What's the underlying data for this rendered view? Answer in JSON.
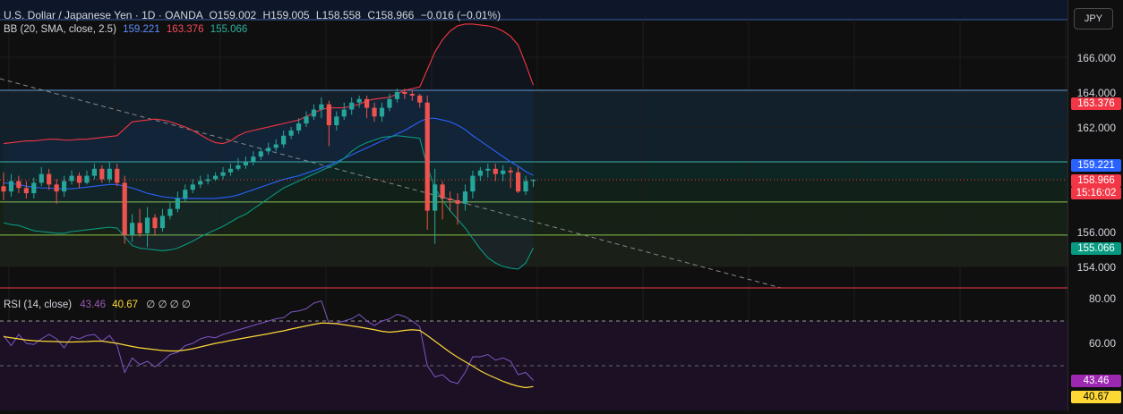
{
  "header": {
    "symbol": "U.S. Dollar / Japanese Yen · 1D · OANDA",
    "open": "O159.002",
    "high": "H159.005",
    "low": "L158.558",
    "close": "C158.966",
    "change": "−0.016 (−0.01%)"
  },
  "bb_legend": {
    "label": "BB (20, SMA, close, 2.5)",
    "basis": "159.221",
    "upper": "163.376",
    "lower": "155.066"
  },
  "rsi_legend": {
    "label": "RSI (14, close)",
    "rsi": "43.46",
    "rsi_ma": "40.67",
    "extra": "∅ ∅ ∅ ∅"
  },
  "currency_button": "JPY",
  "price_ticks": [
    "166.000",
    "164.000",
    "162.000",
    "156.000",
    "154.000"
  ],
  "rsi_ticks": [
    "80.00",
    "60.00"
  ],
  "labels": {
    "upper": "163.376",
    "basis": "159.221",
    "last": "158.966",
    "countdown": "15:16:02",
    "lower": "155.066",
    "rsi": "43.46",
    "rsi_ma": "40.67"
  },
  "colors": {
    "up": "#26a69a",
    "down": "#ef5350",
    "upper_band": "#f23645",
    "basis": "#2962ff",
    "lower_band": "#089981",
    "rsi": "#7e57c2",
    "rsi_ma": "#fdd835",
    "hline_blue": "#5b9bd5",
    "hline_teal": "#3fb1a7",
    "hline_green": "#8bc34a"
  },
  "chart_data": [
    {
      "type": "candlestick",
      "title": "U.S. Dollar / Japanese Yen · 1D · OANDA",
      "ylim": [
        153.2,
        168.4
      ],
      "ticks": [
        154,
        156,
        162,
        164,
        166
      ],
      "series": [
        {
          "name": "OHLC",
          "values": [
            [
              158.6,
              158.3,
              159.4,
              157.8
            ],
            [
              158.3,
              158.9,
              159.3,
              158.0
            ],
            [
              158.9,
              158.5,
              159.2,
              158.2
            ],
            [
              158.5,
              158.2,
              158.9,
              157.9
            ],
            [
              158.2,
              158.8,
              159.1,
              157.9
            ],
            [
              158.8,
              159.3,
              159.7,
              158.6
            ],
            [
              159.3,
              158.7,
              159.6,
              158.4
            ],
            [
              158.7,
              158.3,
              159.0,
              157.6
            ],
            [
              158.3,
              158.9,
              159.2,
              158.0
            ],
            [
              158.9,
              159.2,
              159.5,
              158.7
            ],
            [
              159.2,
              158.8,
              159.4,
              158.5
            ],
            [
              158.8,
              159.2,
              159.5,
              158.7
            ],
            [
              159.2,
              159.6,
              159.9,
              159.0
            ],
            [
              159.6,
              159.0,
              159.8,
              158.8
            ],
            [
              159.0,
              159.6,
              160.0,
              158.8
            ],
            [
              159.6,
              158.8,
              159.9,
              158.6
            ],
            [
              158.8,
              155.8,
              159.2,
              155.3
            ],
            [
              155.8,
              156.5,
              157.0,
              155.4
            ],
            [
              156.5,
              155.9,
              157.3,
              155.7
            ],
            [
              155.9,
              156.8,
              157.4,
              155.1
            ],
            [
              156.8,
              156.2,
              157.0,
              155.8
            ],
            [
              156.2,
              156.9,
              157.3,
              156.0
            ],
            [
              156.9,
              157.3,
              157.7,
              156.7
            ],
            [
              157.3,
              157.9,
              158.3,
              157.1
            ],
            [
              157.9,
              158.4,
              158.7,
              157.7
            ],
            [
              158.4,
              158.7,
              159.0,
              158.2
            ],
            [
              158.7,
              158.9,
              159.2,
              158.5
            ],
            [
              158.9,
              159.0,
              159.3,
              158.7
            ],
            [
              159.0,
              159.2,
              159.4,
              158.9
            ],
            [
              159.2,
              159.4,
              159.7,
              159.0
            ],
            [
              159.4,
              159.6,
              159.9,
              159.2
            ],
            [
              159.6,
              159.8,
              160.2,
              159.5
            ],
            [
              159.8,
              160.0,
              160.3,
              159.6
            ],
            [
              160.0,
              160.3,
              160.6,
              159.8
            ],
            [
              160.3,
              160.6,
              160.8,
              160.1
            ],
            [
              160.6,
              160.8,
              161.1,
              160.4
            ],
            [
              160.8,
              161.0,
              161.3,
              160.6
            ],
            [
              161.0,
              161.5,
              161.8,
              160.8
            ],
            [
              161.5,
              161.8,
              162.0,
              161.3
            ],
            [
              161.8,
              162.2,
              162.5,
              161.6
            ],
            [
              162.2,
              162.6,
              162.9,
              162.0
            ],
            [
              162.6,
              163.0,
              163.3,
              162.4
            ],
            [
              163.0,
              163.3,
              163.7,
              162.5
            ],
            [
              163.3,
              162.1,
              163.5,
              160.9
            ],
            [
              162.1,
              162.6,
              162.9,
              161.8
            ],
            [
              162.6,
              163.0,
              163.4,
              162.4
            ],
            [
              163.0,
              163.4,
              163.7,
              162.7
            ],
            [
              163.4,
              163.6,
              163.8,
              163.1
            ],
            [
              163.6,
              163.1,
              163.8,
              162.5
            ],
            [
              163.1,
              162.6,
              163.4,
              162.3
            ],
            [
              162.6,
              163.1,
              163.4,
              162.3
            ],
            [
              163.1,
              163.6,
              163.9,
              162.9
            ],
            [
              163.6,
              164.0,
              164.2,
              163.4
            ],
            [
              164.0,
              163.9,
              164.2,
              163.6
            ],
            [
              163.9,
              163.8,
              164.1,
              163.5
            ],
            [
              163.8,
              163.4,
              163.9,
              163.1
            ],
            [
              163.4,
              157.2,
              163.8,
              156.1
            ],
            [
              157.2,
              158.7,
              159.6,
              155.3
            ],
            [
              158.7,
              157.9,
              158.9,
              156.7
            ],
            [
              157.9,
              157.8,
              158.3,
              157.2
            ],
            [
              157.8,
              157.6,
              158.2,
              156.4
            ],
            [
              157.6,
              158.3,
              158.7,
              157.2
            ],
            [
              158.3,
              159.2,
              159.5,
              157.9
            ],
            [
              159.2,
              159.5,
              159.7,
              158.9
            ],
            [
              159.5,
              159.6,
              159.9,
              159.1
            ],
            [
              159.6,
              159.3,
              159.9,
              158.9
            ],
            [
              159.3,
              159.5,
              159.8,
              158.9
            ],
            [
              159.5,
              159.4,
              159.7,
              158.5
            ],
            [
              159.4,
              158.3,
              159.7,
              158.2
            ],
            [
              158.3,
              158.9,
              159.2,
              158.1
            ],
            [
              158.9,
              158.966,
              159.005,
              158.558
            ]
          ]
        },
        {
          "name": "BB upper",
          "values": [
            161.05,
            161.1,
            161.15,
            161.2,
            161.2,
            161.25,
            161.3,
            161.3,
            161.25,
            161.25,
            161.3,
            161.3,
            161.35,
            161.4,
            161.45,
            161.5,
            161.9,
            162.3,
            162.35,
            162.4,
            162.45,
            162.4,
            162.3,
            162.15,
            162.0,
            161.8,
            161.55,
            161.3,
            161.1,
            161.05,
            161.2,
            161.5,
            161.7,
            161.8,
            161.9,
            162.0,
            162.1,
            162.2,
            162.3,
            162.4,
            162.6,
            162.8,
            163.0,
            163.1,
            163.1,
            163.1,
            163.2,
            163.3,
            163.5,
            163.6,
            163.65,
            163.7,
            163.9,
            164.1,
            164.2,
            164.3,
            165.3,
            166.3,
            167.0,
            167.5,
            167.8,
            167.9,
            167.9,
            167.85,
            167.8,
            167.7,
            167.5,
            167.2,
            166.7,
            165.6,
            164.4
          ]
        },
        {
          "name": "BB basis",
          "values": [
            158.8,
            158.75,
            158.7,
            158.6,
            158.55,
            158.5,
            158.5,
            158.45,
            158.45,
            158.45,
            158.5,
            158.55,
            158.6,
            158.65,
            158.7,
            158.7,
            158.6,
            158.5,
            158.35,
            158.2,
            158.1,
            158.0,
            157.95,
            157.9,
            157.9,
            157.9,
            157.9,
            157.9,
            157.9,
            157.95,
            158.0,
            158.1,
            158.25,
            158.4,
            158.55,
            158.7,
            158.85,
            159.0,
            159.1,
            159.2,
            159.35,
            159.5,
            159.65,
            159.8,
            160.0,
            160.2,
            160.4,
            160.6,
            160.8,
            161.0,
            161.2,
            161.4,
            161.6,
            161.8,
            162.05,
            162.3,
            162.5,
            162.5,
            162.4,
            162.3,
            162.1,
            161.85,
            161.5,
            161.2,
            160.9,
            160.6,
            160.3,
            160.0,
            159.75,
            159.45,
            159.221
          ]
        },
        {
          "name": "BB lower",
          "values": [
            156.5,
            156.4,
            156.35,
            156.2,
            156.05,
            156.0,
            155.95,
            155.9,
            155.9,
            156.0,
            156.05,
            156.1,
            156.15,
            156.2,
            156.25,
            156.2,
            155.7,
            155.2,
            155.05,
            155.0,
            154.95,
            154.9,
            154.95,
            155.05,
            155.25,
            155.45,
            155.7,
            155.9,
            156.1,
            156.3,
            156.55,
            156.8,
            157.0,
            157.3,
            157.6,
            157.9,
            158.2,
            158.5,
            158.7,
            158.9,
            159.1,
            159.3,
            159.5,
            159.7,
            159.9,
            160.2,
            160.6,
            160.9,
            161.1,
            161.25,
            161.4,
            161.45,
            161.5,
            161.45,
            161.4,
            161.35,
            159.7,
            158.5,
            157.8,
            157.2,
            156.7,
            156.2,
            155.6,
            155.0,
            154.5,
            154.2,
            154.0,
            153.9,
            153.85,
            154.2,
            155.066
          ]
        }
      ]
    },
    {
      "type": "line",
      "title": "RSI (14, close)",
      "ylim": [
        45,
        81
      ],
      "ticks": [
        60,
        80
      ],
      "series": [
        {
          "name": "RSI",
          "values": [
            63.5,
            59,
            64,
            60,
            59.5,
            62,
            64,
            62,
            58,
            63,
            62,
            63.5,
            64,
            61,
            63.5,
            59,
            47,
            53.5,
            50.5,
            52,
            49.5,
            52,
            55,
            56,
            59,
            60,
            62,
            63,
            62.5,
            64,
            65,
            66,
            67,
            68,
            69,
            70,
            71,
            71.5,
            74,
            74.5,
            75.5,
            78,
            79,
            69,
            69,
            70,
            71,
            73,
            70,
            68,
            70,
            71,
            73,
            72,
            70,
            67.5,
            50,
            45,
            46,
            43,
            42,
            47,
            54,
            54,
            55,
            52.5,
            53.5,
            52,
            46,
            47,
            43.46
          ]
        },
        {
          "name": "RSI MA",
          "values": [
            63,
            62.5,
            62,
            61.5,
            61.2,
            61,
            60.9,
            60.8,
            60.6,
            60.6,
            60.7,
            60.8,
            61,
            61,
            60.5,
            60,
            59.3,
            58.6,
            58,
            57.6,
            57.2,
            56.8,
            56.6,
            56.6,
            57,
            57.6,
            58.4,
            59.2,
            60,
            60.6,
            61.3,
            61.9,
            62.5,
            63.1,
            63.7,
            64.3,
            65,
            65.6,
            66.4,
            67.1,
            67.8,
            68.5,
            69.1,
            69,
            68.8,
            68.3,
            67.8,
            67.3,
            66.7,
            66.1,
            65.4,
            65,
            65.3,
            65.8,
            66.1,
            65.8,
            63.5,
            61,
            58.5,
            56,
            53.8,
            51.8,
            49.8,
            47.7,
            46,
            44.5,
            43,
            41.8,
            40.8,
            40.2,
            40.67
          ]
        }
      ]
    }
  ]
}
